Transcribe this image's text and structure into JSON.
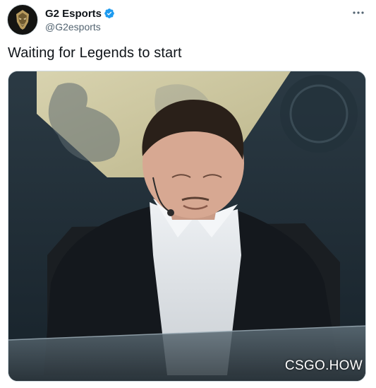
{
  "tweet": {
    "author": {
      "display_name": "G2 Esports",
      "handle": "@G2esports",
      "verified": true,
      "avatar_icon": "g2-samurai-logo-icon"
    },
    "more_icon": "more-options-icon",
    "text": "Waiting for Legends to start",
    "media": {
      "watermark": "CSGO.HOW"
    }
  },
  "colors": {
    "text_primary": "#0f1419",
    "text_secondary": "#536471",
    "verified_blue": "#1d9bf0",
    "border": "#cfd9de"
  }
}
